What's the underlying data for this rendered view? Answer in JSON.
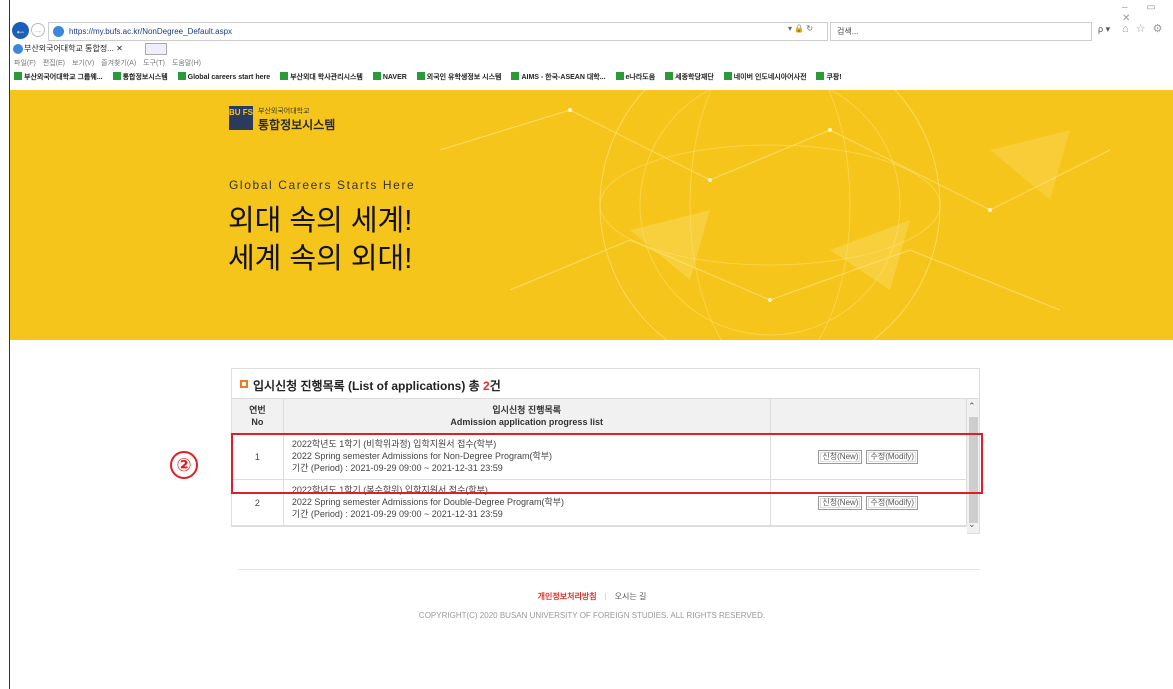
{
  "browser": {
    "url": "https://my.bufs.ac.kr/NonDegree_Default.aspx",
    "addr_tools": "▾ 🔒 ↻",
    "search_placeholder": "검색...",
    "search_go": "ρ ▾",
    "right_icons": "⌂ ☆ ⚙",
    "window_controls": "– ▭ ✕",
    "tab_title": "부산외국어대학교 통합정...  ✕",
    "menu": [
      "파일(F)",
      "편집(E)",
      "보기(V)",
      "즐겨찾기(A)",
      "도구(T)",
      "도움말(H)"
    ],
    "favorites": [
      "부산외국어대학교 그룹웨...",
      "통합정보시스템",
      "Global careers start here",
      "부산외대 학사관리시스템",
      "NAVER",
      "외국인 유학생정보 시스템",
      "AIMS - 한국-ASEAN 대학...",
      "e나라도움",
      "세종학당재단",
      "네이버 인도네시아어사전",
      "쿠팡!"
    ]
  },
  "banner": {
    "logo_mark": "BU FS",
    "logo_sub": "부산외국어대학교",
    "logo_main": "통합정보시스템",
    "tagline": "Global Careers Starts Here",
    "headline_1": "외대 속의 세계!",
    "headline_2": "세계 속의 외대!"
  },
  "list": {
    "title_prefix": "입시신청 진행목록 (List of applications)  총 ",
    "count": "2",
    "title_suffix": "건",
    "col_no_ko": "연번",
    "col_no_en": "No",
    "col_title_ko": "입시신청 진행목록",
    "col_title_en": "Admission application progress list",
    "rows": [
      {
        "no": "1",
        "line1": "2022학년도 1학기 (비학위과정) 입학지원서 접수(학부)",
        "line2": "2022 Spring semester Admissions for Non-Degree Program(학부)",
        "line3": "기간 (Period) : 2021-09-29 09:00 ~ 2021-12-31 23:59",
        "new_label": "신청(New)",
        "modify_label": "수정(Modify)"
      },
      {
        "no": "2",
        "line1": "2022학년도 1학기 (복수학위) 입학지원서 접수(학부)",
        "line2": "2022 Spring semester Admissions for Double-Degree Program(학부)",
        "line3": "기간 (Period) : 2021-09-29 09:00 ~ 2021-12-31 23:59",
        "new_label": "신청(New)",
        "modify_label": "수정(Modify)"
      }
    ]
  },
  "callout": {
    "number": "②",
    "color": "#e21d23"
  },
  "footer": {
    "privacy": "개인정보처리방침",
    "directions": "오시는 길",
    "copyright": "COPYRIGHT(C) 2020 BUSAN UNIVERSITY OF FOREIGN STUDIES. ALL RIGHTS RESERVED."
  },
  "colors": {
    "banner": "#f6c51c",
    "accent_red": "#e0322a",
    "brand_navy": "#2a3b5e"
  }
}
